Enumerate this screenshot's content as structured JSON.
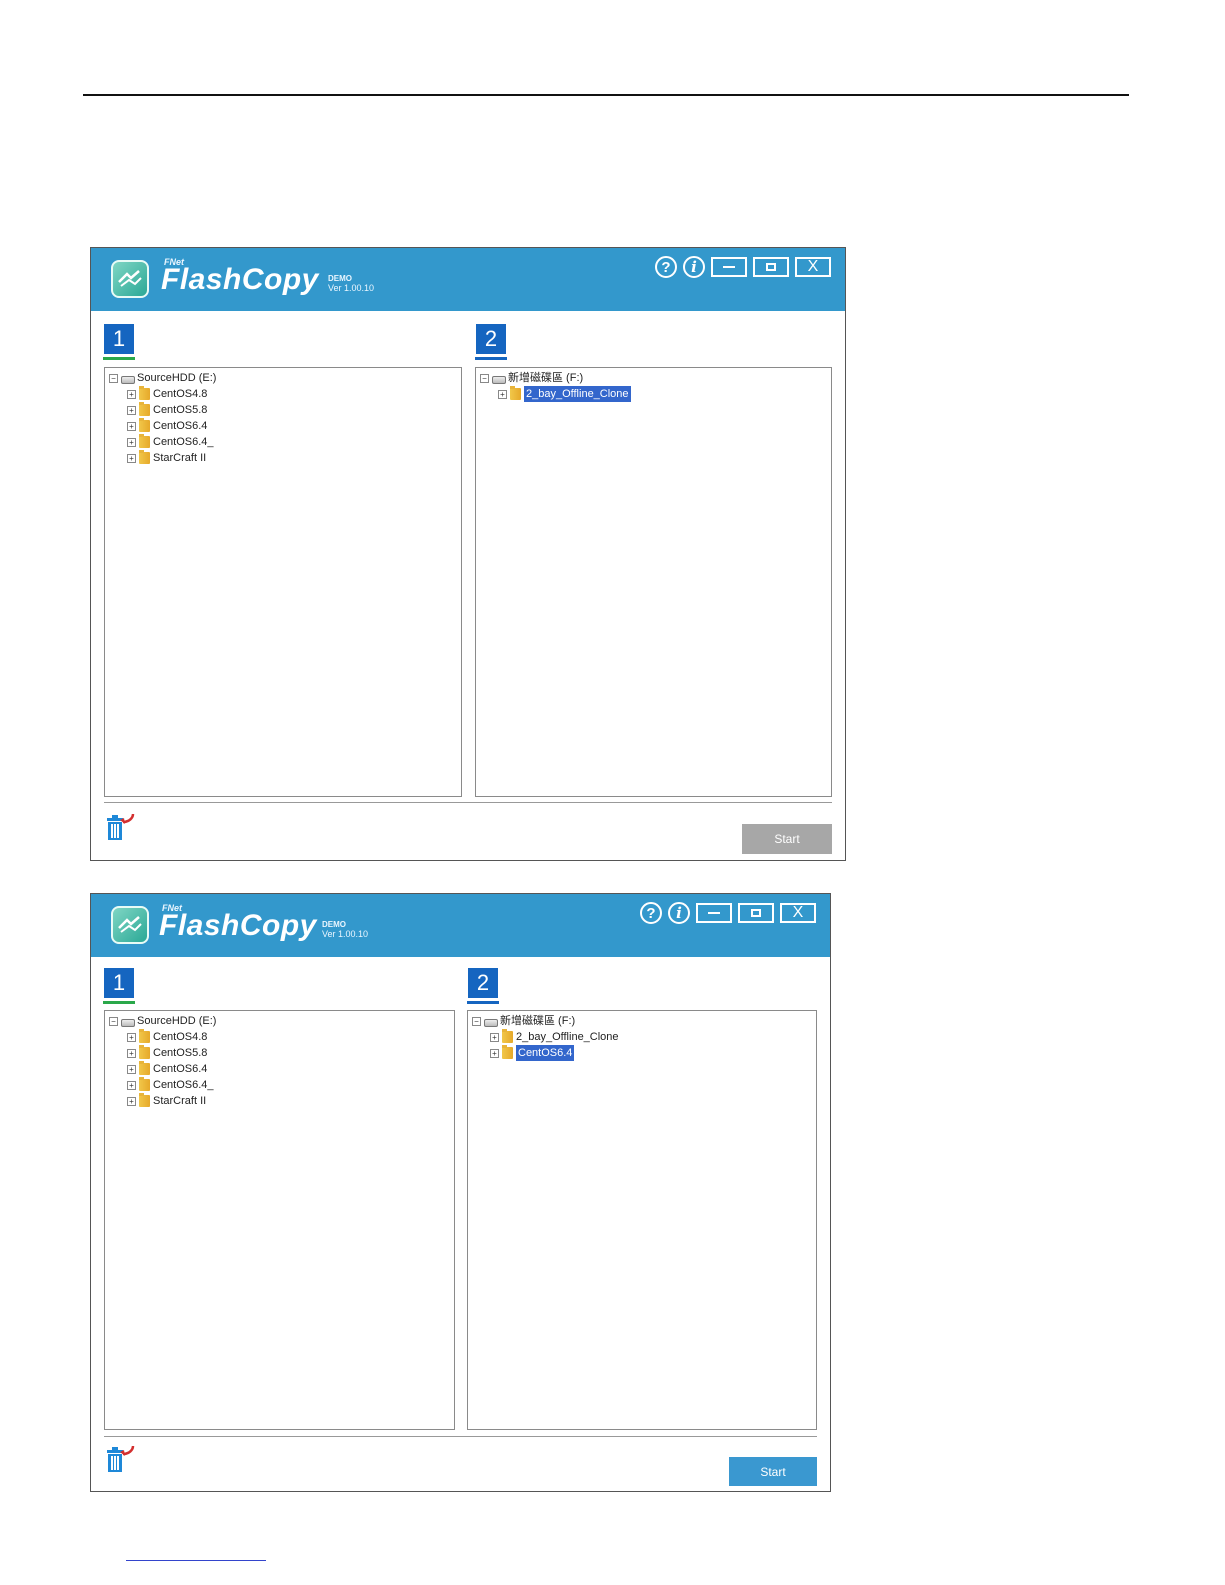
{
  "windows": [
    {
      "header": {
        "brand_small": "FNet",
        "brand": "FlashCopy",
        "edition": "DEMO",
        "version": "Ver 1.00.10",
        "help_glyph": "?",
        "info_glyph": "i",
        "close_glyph": "X"
      },
      "steps": {
        "source": "1",
        "target": "2"
      },
      "source_tree": {
        "root": "SourceHDD (E:)",
        "items": [
          "CentOS4.8",
          "CentOS5.8",
          "CentOS6.4",
          "CentOS6.4_",
          "StarCraft II"
        ]
      },
      "target_tree": {
        "root": "新增磁碟區 (F:)",
        "items": [
          "2_bay_Offline_Clone"
        ],
        "selected_index": 0
      },
      "start_label": "Start",
      "start_state": "disabled"
    },
    {
      "header": {
        "brand_small": "FNet",
        "brand": "FlashCopy",
        "edition": "DEMO",
        "version": "Ver 1.00.10",
        "help_glyph": "?",
        "info_glyph": "i",
        "close_glyph": "X"
      },
      "steps": {
        "source": "1",
        "target": "2"
      },
      "source_tree": {
        "root": "SourceHDD (E:)",
        "items": [
          "CentOS4.8",
          "CentOS5.8",
          "CentOS6.4",
          "CentOS6.4_",
          "StarCraft II"
        ]
      },
      "target_tree": {
        "root": "新增磁碟區 (F:)",
        "items": [
          "2_bay_Offline_Clone",
          "CentOS6.4"
        ],
        "selected_index": 1
      },
      "start_label": "Start",
      "start_state": "enabled"
    }
  ],
  "colors": {
    "header": "#3398cc",
    "step": "#1565c0",
    "selection": "#3366cc",
    "start_enabled": "#3a98d0",
    "start_disabled": "#a7a7a7"
  }
}
